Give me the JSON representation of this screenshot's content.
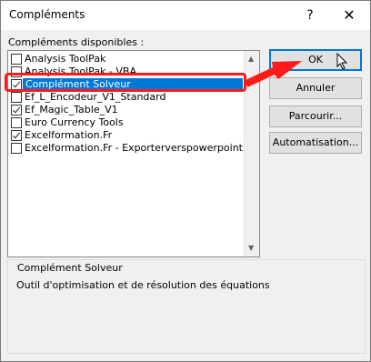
{
  "dialog": {
    "title": "Compléments",
    "help_glyph": "?",
    "close_glyph": "✕"
  },
  "list": {
    "label": "Compléments disponibles :",
    "items": [
      {
        "label": "Analysis ToolPak",
        "checked": false
      },
      {
        "label": "Analysis ToolPak - VBA",
        "checked": false
      },
      {
        "label": "Complément Solveur",
        "checked": true,
        "selected": true
      },
      {
        "label": "Ef_L_Encodeur_V1_Standard",
        "checked": false
      },
      {
        "label": "Ef_Magic_Table_V1",
        "checked": true
      },
      {
        "label": "Euro Currency Tools",
        "checked": false
      },
      {
        "label": "Excelformation.Fr",
        "checked": true
      },
      {
        "label": "Excelformation.Fr - Exporterverspowerpoint",
        "checked": false
      }
    ]
  },
  "buttons": {
    "ok": "OK",
    "cancel": "Annuler",
    "browse": "Parcourir...",
    "automation": "Automatisation..."
  },
  "details": {
    "title": "Complément Solveur",
    "description": "Outil d'optimisation et de résolution des équations"
  },
  "colors": {
    "selection": "#0078d7",
    "annotation": "#ff1a1a"
  }
}
